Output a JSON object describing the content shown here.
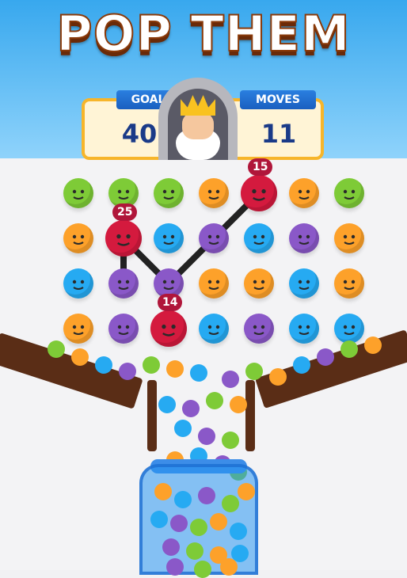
{
  "title": "POP THEM",
  "hud": {
    "goal_label": "GOAL",
    "goal_value": "40",
    "moves_label": "MOVES",
    "moves_value": "11"
  },
  "colors": {
    "green": "#7ecb37",
    "orange": "#fda12a",
    "blue": "#26aaf2",
    "purple": "#8a58c8",
    "red": "#d41a3e"
  },
  "grid": {
    "rows": [
      [
        "green",
        "green",
        "green",
        "orange",
        "red",
        "orange",
        "green"
      ],
      [
        "orange",
        "red",
        "blue",
        "purple",
        "blue",
        "purple",
        "orange"
      ],
      [
        "blue",
        "purple",
        "purple",
        "orange",
        "orange",
        "blue",
        "orange"
      ],
      [
        "orange",
        "purple",
        "red",
        "blue",
        "purple",
        "blue",
        "blue"
      ]
    ]
  },
  "bombs": [
    {
      "row": 0,
      "col": 4,
      "count": "15"
    },
    {
      "row": 1,
      "col": 1,
      "count": "25"
    },
    {
      "row": 3,
      "col": 2,
      "count": "14"
    }
  ]
}
